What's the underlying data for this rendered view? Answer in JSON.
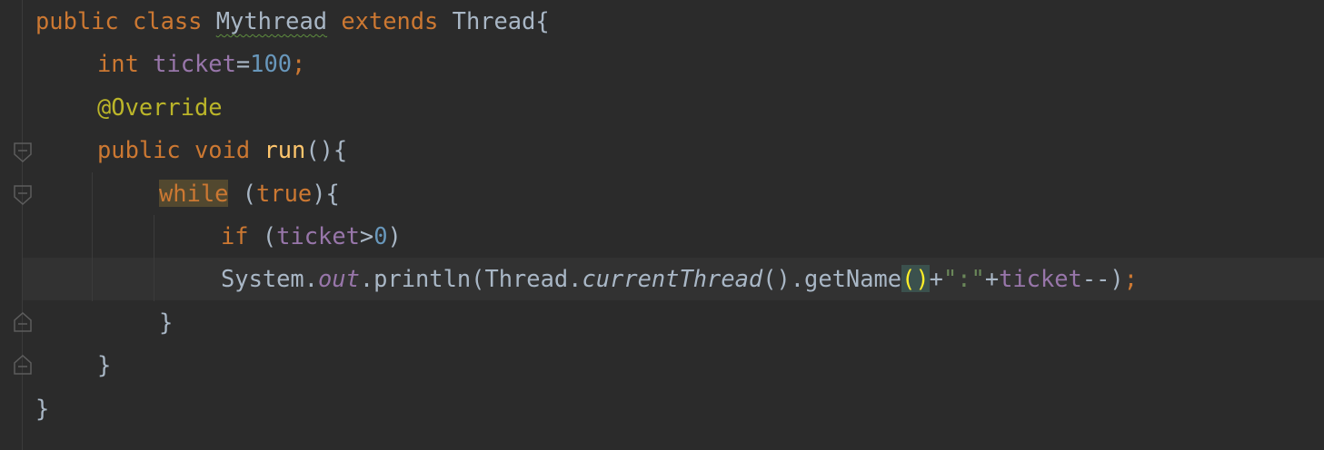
{
  "editor": {
    "language": "Java",
    "theme": "Darcula",
    "caret_line_number": 7,
    "colors": {
      "background": "#2b2b2b",
      "keyword": "#cc7832",
      "field": "#9876aa",
      "number": "#6897bb",
      "annotation": "#bbb529",
      "method_declaration": "#ffc66d",
      "string": "#6a8759",
      "default_text": "#a9b7c6"
    },
    "gutter_fold_icons": [
      "fold-open-icon",
      "fold-open-icon",
      "fold-close-icon",
      "fold-close-icon"
    ]
  },
  "code": {
    "line1": {
      "kw_public": "public",
      "kw_class": "class",
      "class_name": "Mythread",
      "kw_extends": "extends",
      "super_class": "Thread",
      "brace_open": "{"
    },
    "line2": {
      "kw_int": "int",
      "field_ticket": "ticket",
      "assign": "=",
      "value": "100",
      "semi": ";"
    },
    "line3": {
      "annotation": "@Override"
    },
    "line4": {
      "kw_public": "public",
      "kw_void": "void",
      "method_run": "run",
      "signature_end": "(){"
    },
    "line5": {
      "kw_while": "while",
      "paren_open": "(",
      "kw_true": "true",
      "paren_close_brace": "){"
    },
    "line6": {
      "kw_if": "if",
      "paren_open": "(",
      "field_ticket": "ticket",
      "gt": ">",
      "zero": "0",
      "paren_close": ")"
    },
    "line7": {
      "system": "System",
      "dot1": ".",
      "out": "out",
      "println_call": ".println(Thread.",
      "current_thread": "currentThread",
      "get_name_call": "().getName",
      "matched_parens": "()",
      "plus1": "+",
      "string_colon": "\":\"",
      "plus2": "+",
      "field_ticket": "ticket",
      "decrement_close": "--)",
      "semi": ";"
    },
    "line8": {
      "brace_close": "}"
    },
    "line9": {
      "brace_close": "}"
    },
    "line10": {
      "brace_close": "}"
    }
  }
}
